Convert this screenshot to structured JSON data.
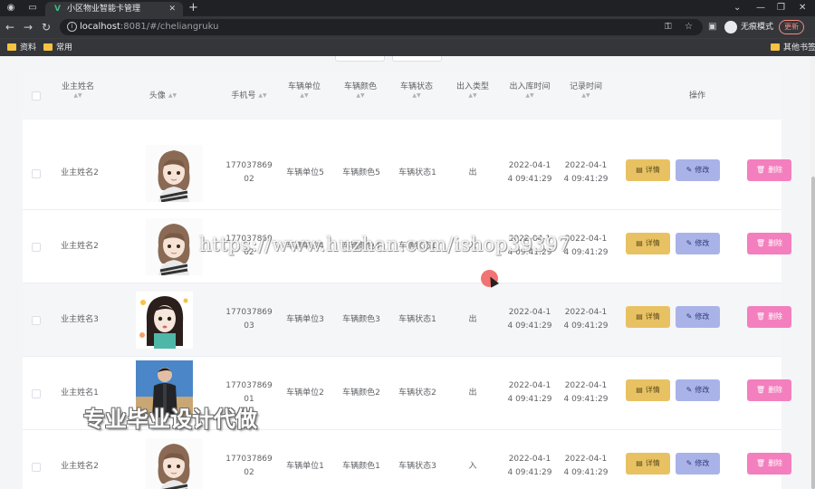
{
  "browser": {
    "tab_title": "小区物业智能卡管理",
    "url_host": "localhost",
    "url_rest": ":8081/#/cheliangruku",
    "incognito_label": "无痕模式",
    "update_label": "更新",
    "bookmarks": [
      "资料",
      "常用"
    ],
    "other_bookmarks": "其他书签"
  },
  "table": {
    "headers": {
      "owner_name": "业主姓名",
      "avatar": "头像",
      "phone": "手机号",
      "unit": "车辆单位",
      "color": "车辆颜色",
      "status": "车辆状态",
      "io_type": "出入类型",
      "io_time": "出入库时间",
      "record_time": "记录时间",
      "actions": "操作"
    },
    "actions": {
      "detail": "详情",
      "edit": "修改",
      "delete": "删除"
    },
    "rows": [
      {
        "owner_name": "业主姓名2",
        "avatar": "girl-cartoon",
        "phone_a": "177037869",
        "phone_b": "02",
        "unit": "车辆单位5",
        "color": "车辆颜色5",
        "status": "车辆状态1",
        "io_type": "出",
        "io_time_a": "2022-04-1",
        "io_time_b": "4 09:41:29",
        "record_time_a": "2022-04-1",
        "record_time_b": "4 09:41:29"
      },
      {
        "owner_name": "业主姓名2",
        "avatar": "girl-cartoon",
        "phone_a": "177037869",
        "phone_b": "02",
        "unit": "车辆单位4",
        "color": "车辆颜色4",
        "status": "车辆状态1",
        "io_type": "入",
        "io_time_a": "2022-04-1",
        "io_time_b": "4 09:41:29",
        "record_time_a": "2022-04-1",
        "record_time_b": "4 09:41:29"
      },
      {
        "owner_name": "业主姓名3",
        "avatar": "girl-sticker",
        "phone_a": "177037869",
        "phone_b": "03",
        "unit": "车辆单位3",
        "color": "车辆颜色3",
        "status": "车辆状态1",
        "io_type": "出",
        "io_time_a": "2022-04-1",
        "io_time_b": "4 09:41:29",
        "record_time_a": "2022-04-1",
        "record_time_b": "4 09:41:29"
      },
      {
        "owner_name": "业主姓名1",
        "avatar": "man-photo",
        "phone_a": "177037869",
        "phone_b": "01",
        "unit": "车辆单位2",
        "color": "车辆颜色2",
        "status": "车辆状态2",
        "io_type": "出",
        "io_time_a": "2022-04-1",
        "io_time_b": "4 09:41:29",
        "record_time_a": "2022-04-1",
        "record_time_b": "4 09:41:29"
      },
      {
        "owner_name": "业主姓名2",
        "avatar": "girl-cartoon",
        "phone_a": "177037869",
        "phone_b": "02",
        "unit": "车辆单位1",
        "color": "车辆颜色1",
        "status": "车辆状态3",
        "io_type": "入",
        "io_time_a": "2022-04-1",
        "io_time_b": "4 09:41:29",
        "record_time_a": "2022-04-1",
        "record_time_b": "4 09:41:29"
      }
    ]
  },
  "overlay": {
    "watermark_url": "https://www.huzhan.com/ishop39397",
    "watermark_text": "专业毕业设计代做"
  },
  "colors": {
    "detail_button": "#e8c262",
    "edit_button": "#a9b3e8",
    "delete_button": "#f37fbe",
    "header_bg": "#f5f6f8"
  }
}
